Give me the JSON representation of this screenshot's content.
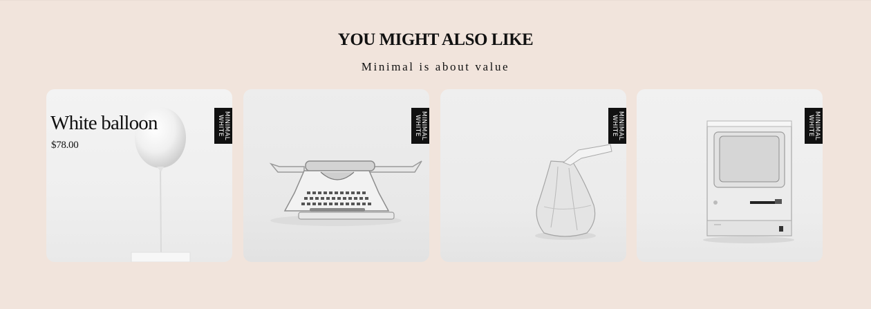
{
  "section": {
    "title": "YOU MIGHT ALSO LIKE",
    "subtitle": "Minimal is about value"
  },
  "brand_tag": "MINIMAL\nWHITE",
  "products": [
    {
      "name": "White balloon",
      "price": "$78.00",
      "image": "balloon-image"
    },
    {
      "image": "typewriter-image"
    },
    {
      "image": "wrapped-candy-image"
    },
    {
      "image": "vintage-computer-image"
    }
  ],
  "colors": {
    "background": "#f1e4dc",
    "card_background": "#eeeeee",
    "tag_background": "#111111",
    "text": "#111111"
  }
}
